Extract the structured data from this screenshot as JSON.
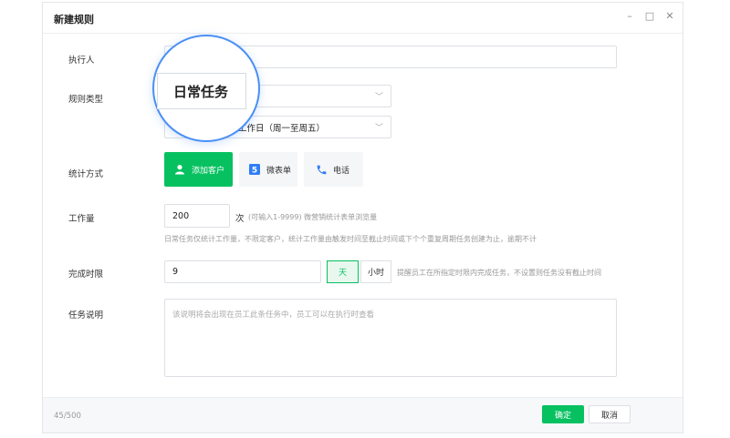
{
  "window": {
    "title": "新建规则",
    "minimize_label": "–",
    "maximize_label": "□",
    "close_label": "✕"
  },
  "form": {
    "executor": {
      "label": "执行人",
      "value": ""
    },
    "rule_type": {
      "label": "规则类型",
      "value": "日常任务",
      "frequency": "工作日（周一至周五）"
    },
    "stat_method": {
      "label": "统计方式",
      "options": [
        {
          "label": "添加客户",
          "icon": "user-icon",
          "selected": true
        },
        {
          "label": "微表单",
          "icon": "form-icon",
          "selected": false
        },
        {
          "label": "电话",
          "icon": "phone-icon",
          "selected": false
        }
      ]
    },
    "workload": {
      "label": "工作量",
      "value": "200",
      "unit": "次",
      "range_hint": "(可输入1-9999) 微营销统计表单浏览量",
      "note": "日常任务仅统计工作量，不限定客户，统计工作量由触发时间至截止时间或下个个重复周期任务创建为止，逾期不计"
    },
    "deadline": {
      "label": "完成时限",
      "value": "9",
      "unit_day": "天",
      "unit_hour": "小时",
      "hint": "提醒员工在所指定时限内完成任务，不设置则任务没有截止时间"
    },
    "description": {
      "label": "任务说明",
      "placeholder": "该说明将会出现在员工此条任务中，员工可以在执行时查看"
    }
  },
  "footer": {
    "char_count": "45/500",
    "confirm_label": "确定",
    "cancel_label": "取消"
  },
  "colors": {
    "accent": "#07c160",
    "magnifier_ring": "#4a90f5",
    "form_icon": "#2f7df6",
    "phone_icon": "#2f7df6"
  }
}
